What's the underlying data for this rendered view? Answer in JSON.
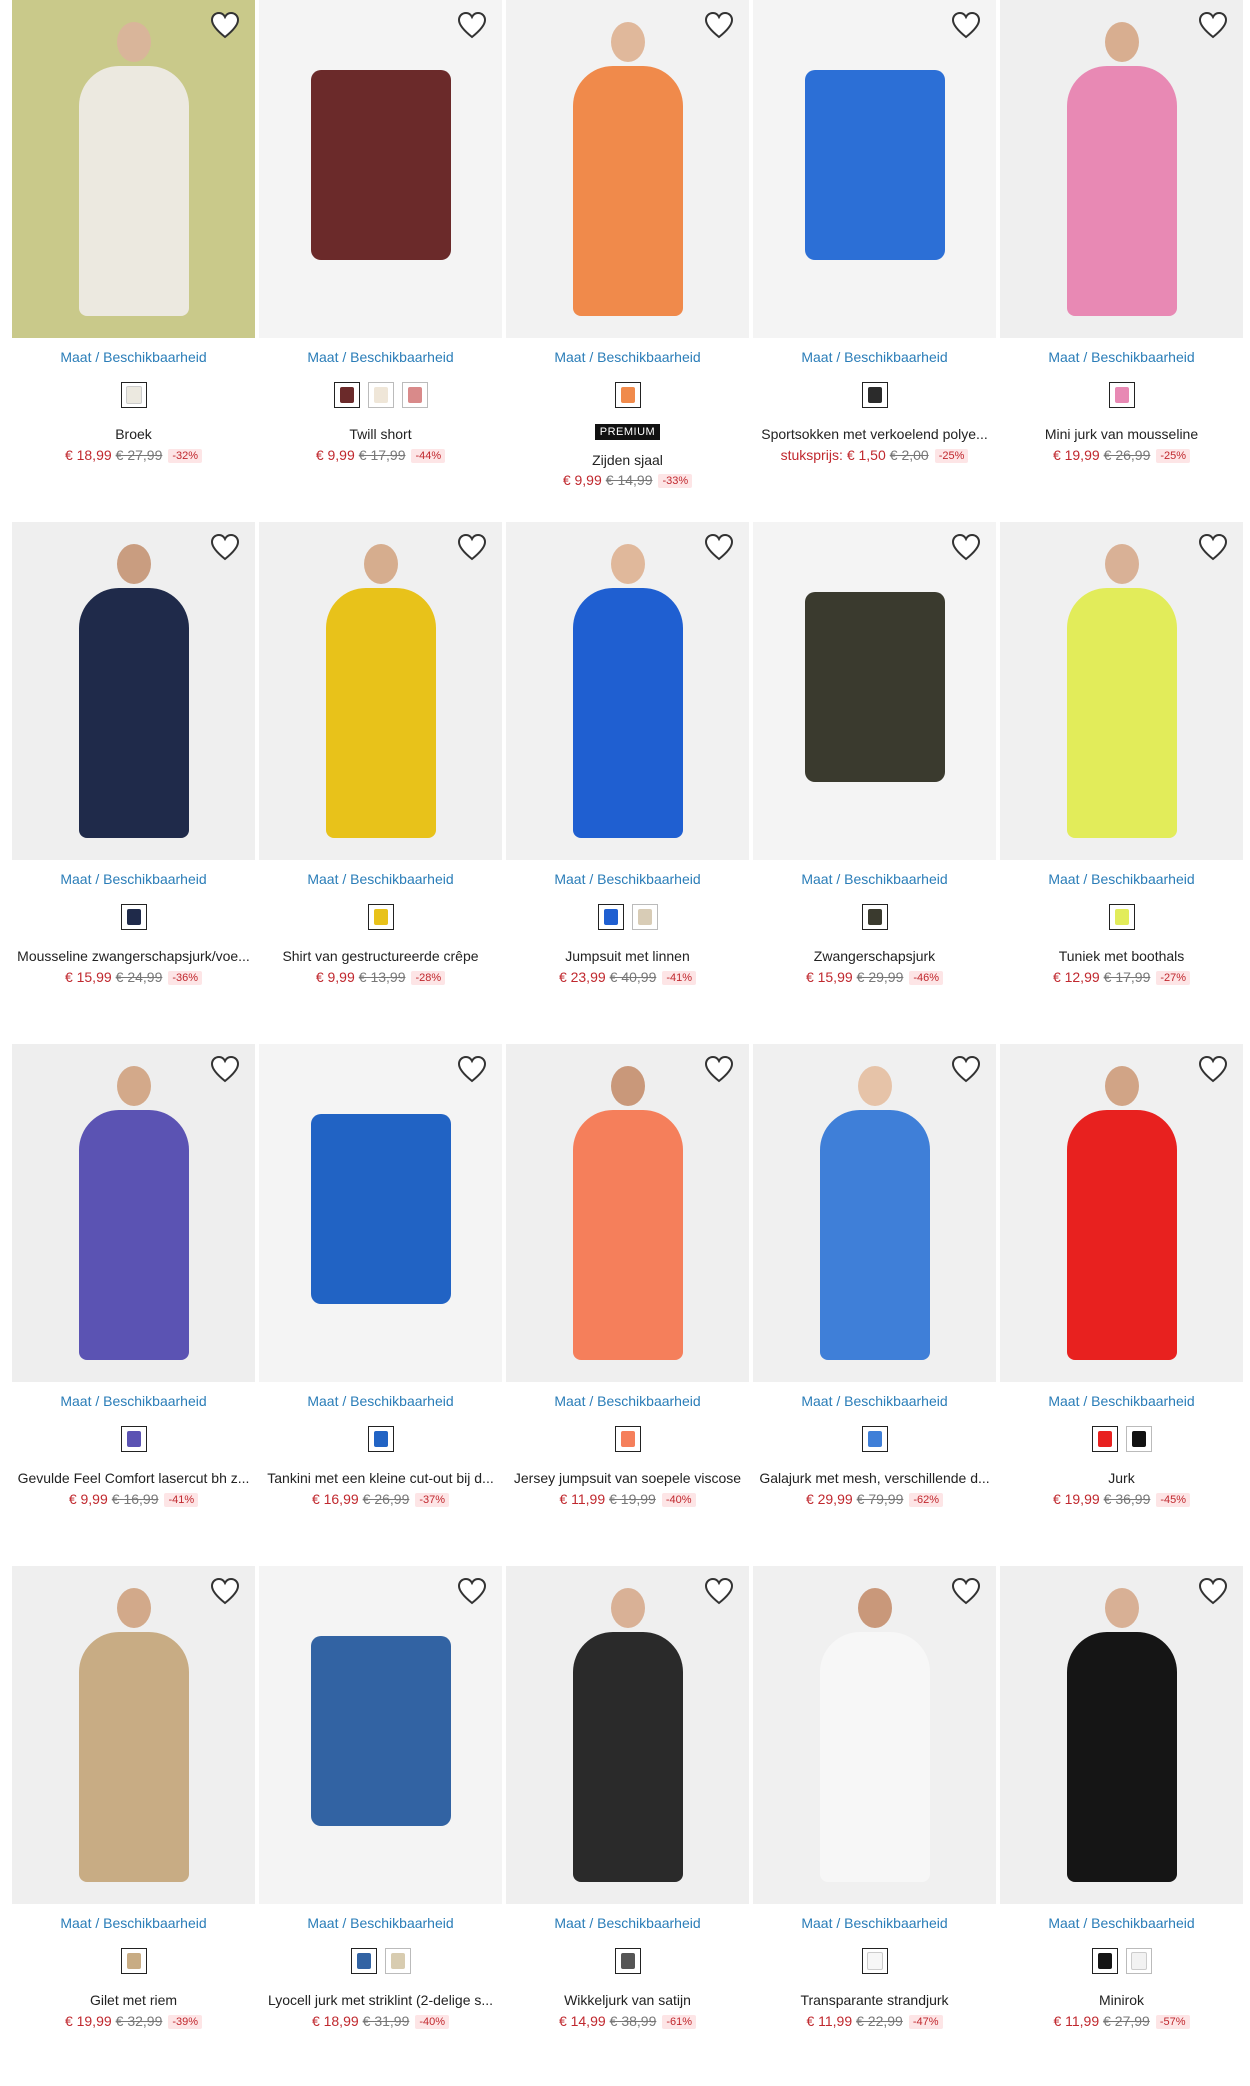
{
  "size_link_label": "Maat / Beschikbaarheid",
  "colors": {
    "link": "#2a7db8",
    "sale": "#c0282e",
    "discount_bg": "#fde5e6"
  },
  "products": [
    {
      "title": "Broek",
      "price": "€ 18,99",
      "old_price": "€ 27,99",
      "discount": "-32%",
      "bg": "#c9c98a",
      "garment": "#ece9e0",
      "skin": "#d9b59a",
      "swatches": [
        "#ece9e0"
      ]
    },
    {
      "title": "Twill short",
      "price": "€ 9,99",
      "old_price": "€ 17,99",
      "discount": "-44%",
      "bg": "#f4f4f4",
      "garment": "#6b2a2a",
      "skin": "",
      "swatches": [
        "#6b2a2a",
        "#efe6d8",
        "#d98a8a"
      ]
    },
    {
      "title": "Zijden sjaal",
      "badge": "PREMIUM",
      "price": "€ 9,99",
      "old_price": "€ 14,99",
      "discount": "-33%",
      "bg": "#f2f2f2",
      "garment": "#f08a4b",
      "skin": "#e0b89b",
      "swatches": [
        "#f08a4b"
      ]
    },
    {
      "title": "Sportsokken met verkoelend polye...",
      "price_label": "stuksprijs:",
      "price": "€ 1,50",
      "old_price": "€ 2,00",
      "discount": "-25%",
      "bg": "#f4f4f4",
      "garment": "#2c6fd6",
      "skin": "",
      "swatches": [
        "#2b2b2b"
      ]
    },
    {
      "title": "Mini jurk van mousseline",
      "price": "€ 19,99",
      "old_price": "€ 26,99",
      "discount": "-25%",
      "bg": "#efefef",
      "garment": "#e889b4",
      "skin": "#d8ae90",
      "swatches": [
        "#e889b4"
      ]
    },
    {
      "title": "Mousseline zwangerschapsjurk/voe...",
      "price": "€ 15,99",
      "old_price": "€ 24,99",
      "discount": "-36%",
      "bg": "#efefef",
      "garment": "#1f2a4a",
      "skin": "#c99d80",
      "swatches": [
        "#1f2a4a"
      ]
    },
    {
      "title": "Shirt van gestructureerde crêpe",
      "price": "€ 9,99",
      "old_price": "€ 13,99",
      "discount": "-28%",
      "bg": "#f0f0f0",
      "garment": "#e8c21a",
      "skin": "#d6ad8e",
      "swatches": [
        "#e8c21a"
      ]
    },
    {
      "title": "Jumpsuit met linnen",
      "price": "€ 23,99",
      "old_price": "€ 40,99",
      "discount": "-41%",
      "bg": "#f1f1f1",
      "garment": "#1f5fd1",
      "skin": "#e0b89b",
      "swatches": [
        "#1f5fd1",
        "#d8ccb6"
      ]
    },
    {
      "title": "Zwangerschapsjurk",
      "price": "€ 15,99",
      "old_price": "€ 29,99",
      "discount": "-46%",
      "bg": "#f4f4f4",
      "garment": "#3a3a2e",
      "skin": "",
      "swatches": [
        "#3a3a2e"
      ]
    },
    {
      "title": "Tuniek met boothals",
      "price": "€ 12,99",
      "old_price": "€ 17,99",
      "discount": "-27%",
      "bg": "#f0f0f0",
      "garment": "#e2ec5a",
      "skin": "#d9b196",
      "swatches": [
        "#e2ec5a"
      ]
    },
    {
      "title": "Gevulde Feel Comfort lasercut bh z...",
      "price": "€ 9,99",
      "old_price": "€ 16,99",
      "discount": "-41%",
      "bg": "#eeeeee",
      "garment": "#5b53b3",
      "skin": "#d3a98a",
      "swatches": [
        "#5b53b3"
      ]
    },
    {
      "title": "Tankini met een kleine cut-out bij d...",
      "price": "€ 16,99",
      "old_price": "€ 26,99",
      "discount": "-37%",
      "bg": "#f4f4f4",
      "garment": "#2163c4",
      "skin": "",
      "swatches": [
        "#2163c4"
      ]
    },
    {
      "title": "Jersey jumpsuit van soepele viscose",
      "price": "€ 11,99",
      "old_price": "€ 19,99",
      "discount": "-40%",
      "bg": "#efefef",
      "garment": "#f57f5b",
      "skin": "#c9987a",
      "swatches": [
        "#f57f5b"
      ]
    },
    {
      "title": "Galajurk met mesh, verschillende d...",
      "price": "€ 29,99",
      "old_price": "€ 79,99",
      "discount": "-62%",
      "bg": "#f0f0f0",
      "garment": "#3f7fd8",
      "skin": "#e6c3a8",
      "swatches": [
        "#3f7fd8"
      ]
    },
    {
      "title": "Jurk",
      "price": "€ 19,99",
      "old_price": "€ 36,99",
      "discount": "-45%",
      "bg": "#f0f0f0",
      "garment": "#e8211f",
      "skin": "#d1a486",
      "swatches": [
        "#e8211f",
        "#111111"
      ]
    },
    {
      "title": "Gilet met riem",
      "price": "€ 19,99",
      "old_price": "€ 32,99",
      "discount": "-39%",
      "bg": "#efefef",
      "garment": "#c8ac84",
      "skin": "#d2a98a",
      "swatches": [
        "#c8ac84"
      ]
    },
    {
      "title": "Lyocell jurk met striklint (2-delige s...",
      "price": "€ 18,99",
      "old_price": "€ 31,99",
      "discount": "-40%",
      "bg": "#f4f4f4",
      "garment": "#3263a3",
      "skin": "",
      "swatches": [
        "#3263a3",
        "#d8ccb0"
      ]
    },
    {
      "title": "Wikkeljurk van satijn",
      "price": "€ 14,99",
      "old_price": "€ 38,99",
      "discount": "-61%",
      "bg": "#efefef",
      "garment": "#2a2a2a",
      "skin": "#d9b196",
      "swatches": [
        "#555555"
      ]
    },
    {
      "title": "Transparante strandjurk",
      "price": "€ 11,99",
      "old_price": "€ 22,99",
      "discount": "-47%",
      "bg": "#f0f0f0",
      "garment": "#f7f7f7",
      "skin": "#c9987a",
      "swatches": [
        "#f7f7f7"
      ]
    },
    {
      "title": "Minirok",
      "price": "€ 11,99",
      "old_price": "€ 27,99",
      "discount": "-57%",
      "bg": "#efefef",
      "garment": "#151515",
      "skin": "#d8b095",
      "swatches": [
        "#151515",
        "#f2f2f2"
      ]
    }
  ]
}
